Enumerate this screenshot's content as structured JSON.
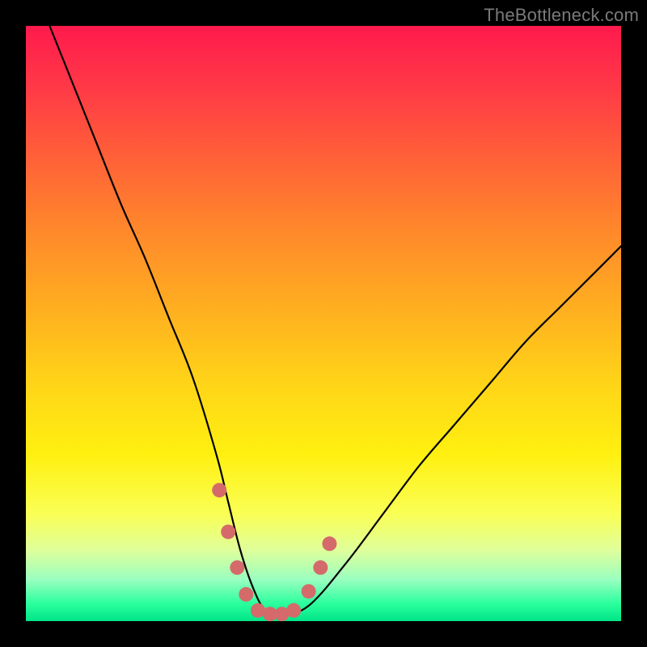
{
  "watermark": {
    "text": "TheBottleneck.com"
  },
  "chart_data": {
    "type": "line",
    "title": "",
    "xlabel": "",
    "ylabel": "",
    "xlim": [
      0,
      100
    ],
    "ylim": [
      0,
      100
    ],
    "grid": false,
    "series": [
      {
        "name": "bottleneck-curve",
        "x": [
          4,
          8,
          12,
          16,
          20,
          24,
          28,
          32,
          34,
          36,
          38,
          40,
          42,
          44,
          48,
          54,
          60,
          66,
          72,
          78,
          84,
          90,
          96,
          100
        ],
        "values": [
          100,
          90,
          80,
          70,
          61,
          51,
          41,
          28,
          20,
          12,
          6,
          2,
          1,
          1,
          3,
          10,
          18,
          26,
          33,
          40,
          47,
          53,
          59,
          63
        ]
      }
    ],
    "highlights": [
      {
        "name": "threshold-dots",
        "color": "#d46a6a",
        "points": [
          {
            "x": 32.5,
            "y": 22
          },
          {
            "x": 34.0,
            "y": 15
          },
          {
            "x": 35.5,
            "y": 9
          },
          {
            "x": 37.0,
            "y": 4.5
          },
          {
            "x": 39.0,
            "y": 1.8
          },
          {
            "x": 41.0,
            "y": 1.2
          },
          {
            "x": 43.0,
            "y": 1.2
          },
          {
            "x": 45.0,
            "y": 1.8
          },
          {
            "x": 47.5,
            "y": 5
          },
          {
            "x": 49.5,
            "y": 9
          },
          {
            "x": 51.0,
            "y": 13
          }
        ]
      }
    ],
    "background": {
      "type": "vertical-gradient",
      "stops": [
        {
          "pct": 0,
          "color": "#ff1a4d"
        },
        {
          "pct": 50,
          "color": "#ffc81e"
        },
        {
          "pct": 82,
          "color": "#faff55"
        },
        {
          "pct": 100,
          "color": "#00e588"
        }
      ]
    }
  }
}
